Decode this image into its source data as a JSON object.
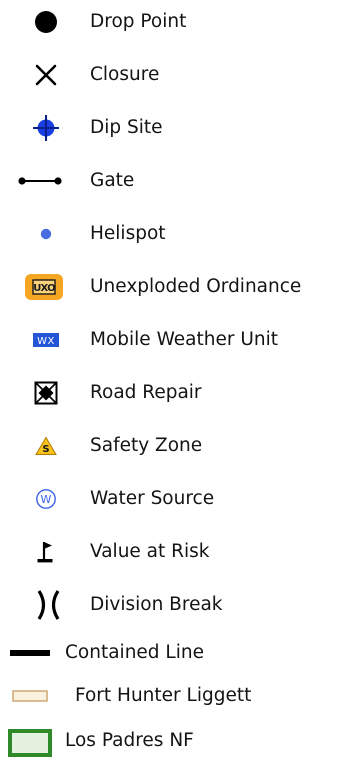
{
  "legend": {
    "items": [
      {
        "label": "Drop Point",
        "icon": "drop-point-icon"
      },
      {
        "label": "Closure",
        "icon": "closure-icon"
      },
      {
        "label": "Dip Site",
        "icon": "dip-site-icon"
      },
      {
        "label": "Gate",
        "icon": "gate-icon"
      },
      {
        "label": "Helispot",
        "icon": "helispot-icon"
      },
      {
        "label": "Unexploded Ordinance",
        "icon": "unexploded-ordinance-icon",
        "badge": "UXO"
      },
      {
        "label": "Mobile Weather Unit",
        "icon": "mobile-weather-unit-icon",
        "badge": "WX"
      },
      {
        "label": "Road Repair",
        "icon": "road-repair-icon"
      },
      {
        "label": "Safety Zone",
        "icon": "safety-zone-icon",
        "badge": "S"
      },
      {
        "label": "Water Source",
        "icon": "water-source-icon",
        "badge": "W"
      },
      {
        "label": "Value at Risk",
        "icon": "value-at-risk-icon"
      },
      {
        "label": "Division Break",
        "icon": "division-break-icon"
      },
      {
        "label": "Contained Line",
        "icon": "contained-line-icon"
      },
      {
        "label": "Fort Hunter Liggett",
        "icon": "fort-hunter-liggett-icon"
      },
      {
        "label": "Los Padres NF",
        "icon": "los-padres-nf-icon"
      }
    ]
  },
  "colors": {
    "symbol_black": "#000000",
    "dip_site_blue": "#1a3fe0",
    "helispot_blue": "#4a6ee0",
    "uxo_orange": "#f5a623",
    "wx_blue": "#2356d6",
    "safety_yellow": "#f7c21a",
    "water_blue": "#3a62e8",
    "fort_fill": "#fbf1e0",
    "fort_border": "#c8a468",
    "padres_fill": "#e6f2e0",
    "padres_border": "#2f8a2a"
  }
}
